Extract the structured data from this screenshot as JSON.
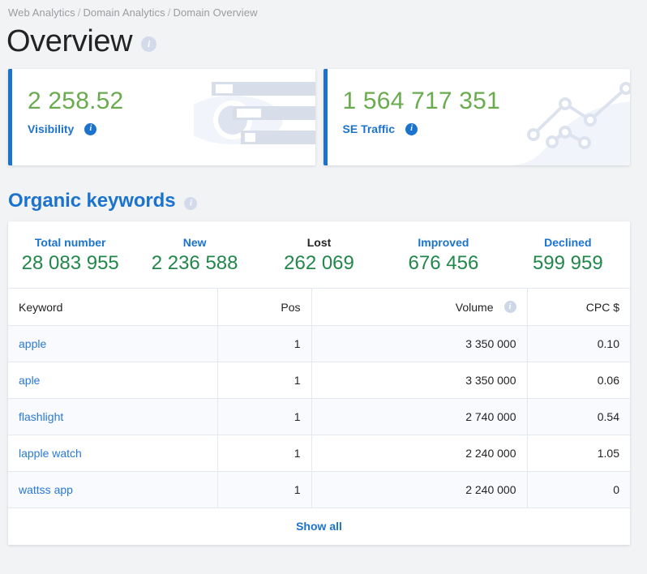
{
  "breadcrumb": {
    "items": [
      "Web Analytics",
      "Domain Analytics",
      "Domain Overview"
    ],
    "separator": "/"
  },
  "header": {
    "title": "Overview",
    "info_icon": "info-icon"
  },
  "cards": [
    {
      "value": "2 258.52",
      "label": "Visibility",
      "accent_color": "#1c73cd",
      "value_color": "#6aab50",
      "art": "eye-icon"
    },
    {
      "value": "1 564 717 351",
      "label": "SE Traffic",
      "accent_color": "#1c73cd",
      "value_color": "#6aab50",
      "art": "line-chart-icon"
    }
  ],
  "organic": {
    "title": "Organic keywords",
    "stats": [
      {
        "label": "Total number",
        "value": "28 083 955",
        "active": false
      },
      {
        "label": "New",
        "value": "2 236 588",
        "active": false
      },
      {
        "label": "Lost",
        "value": "262 069",
        "active": true
      },
      {
        "label": "Improved",
        "value": "676 456",
        "active": false
      },
      {
        "label": "Declined",
        "value": "599 959",
        "active": false
      }
    ],
    "table": {
      "columns": [
        "Keyword",
        "Pos",
        "Volume",
        "CPC $"
      ],
      "rows": [
        {
          "keyword": "apple",
          "pos": "1",
          "volume": "3 350 000",
          "cpc": "0.10"
        },
        {
          "keyword": "aple",
          "pos": "1",
          "volume": "3 350 000",
          "cpc": "0.06"
        },
        {
          "keyword": "flashlight",
          "pos": "1",
          "volume": "2 740 000",
          "cpc": "0.54"
        },
        {
          "keyword": "lapple watch",
          "pos": "1",
          "volume": "2 240 000",
          "cpc": "1.05"
        },
        {
          "keyword": "wattss app",
          "pos": "1",
          "volume": "2 240 000",
          "cpc": "0"
        }
      ],
      "show_all": "Show all"
    }
  }
}
